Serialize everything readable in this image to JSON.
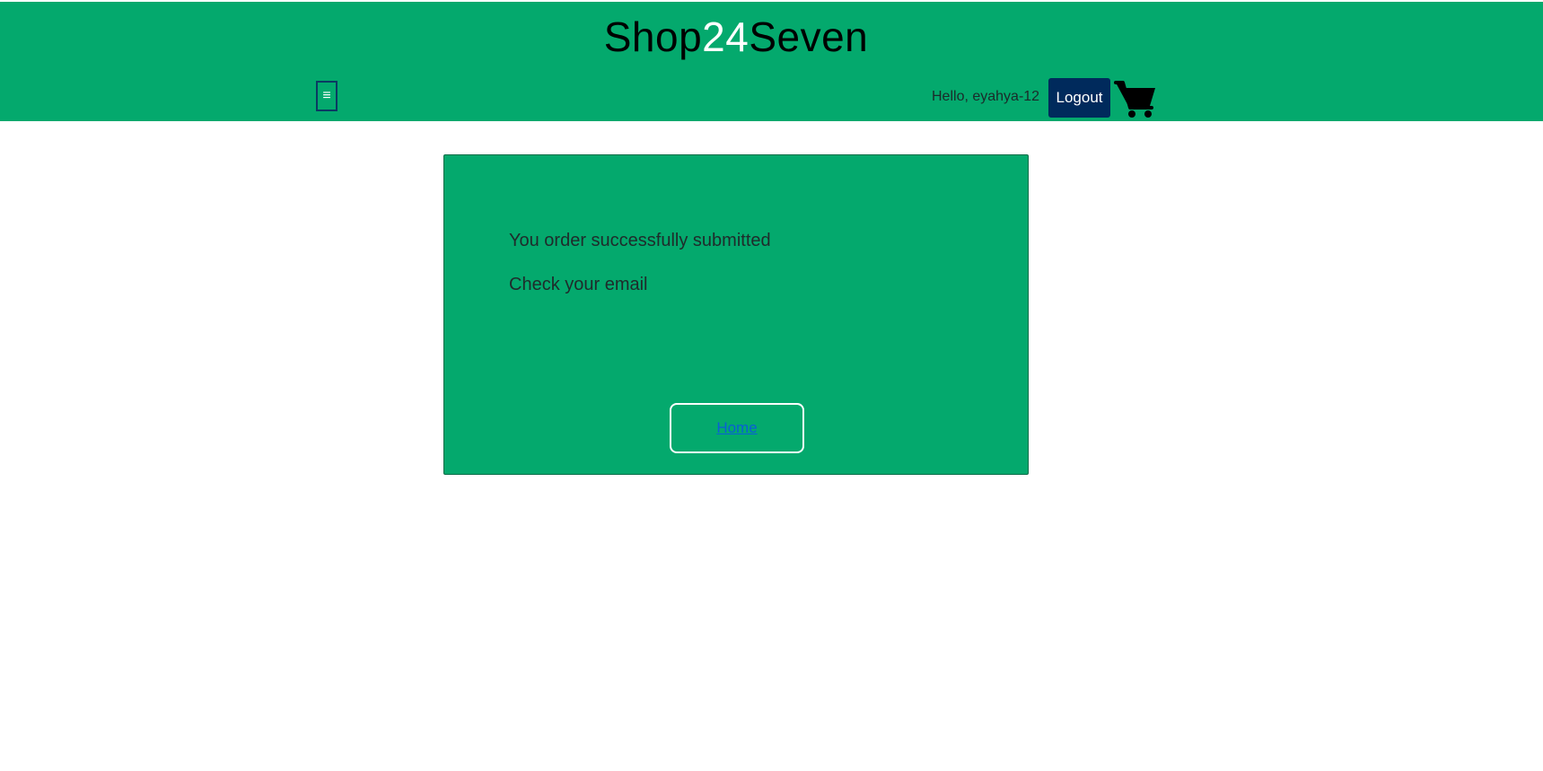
{
  "header": {
    "brand": {
      "part1": "Shop",
      "part2": "24",
      "part3": "Seven"
    },
    "menu_icon_glyph": "≡",
    "menu_icon": "hamburger-menu-icon",
    "greeting": "Hello, eyahya-12",
    "logout_label": "Logout",
    "cart_icon": "shopping-cart-icon"
  },
  "main": {
    "message_line1": "You order successfully submitted",
    "message_line2": "Check your email",
    "home_label": "Home"
  },
  "colors": {
    "brand_green": "#04a96d",
    "logout_navy": "#002a5c",
    "link_blue": "#0a5fd6"
  }
}
